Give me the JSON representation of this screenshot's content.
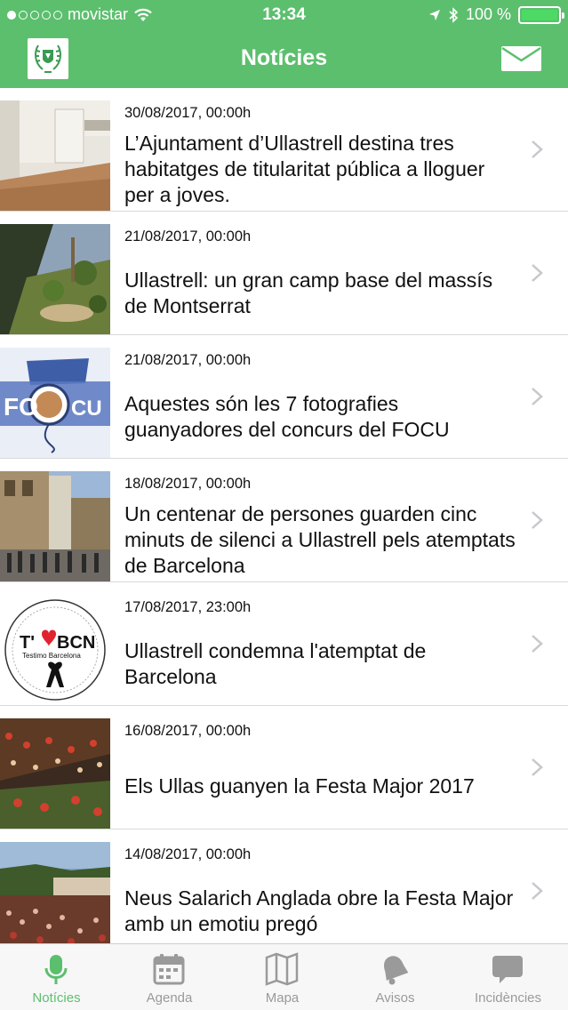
{
  "status_bar": {
    "carrier": "movistar",
    "time": "13:34",
    "battery": "100 %"
  },
  "header": {
    "title": "Notícies"
  },
  "news": [
    {
      "date": "30/08/2017, 00:00h",
      "title": "L’Ajuntament d’Ullastrell destina tres habitatges de titularitat pública a lloguer per a joves."
    },
    {
      "date": "21/08/2017, 00:00h",
      "title": "Ullastrell: un gran camp base del massís de Montserrat"
    },
    {
      "date": "21/08/2017, 00:00h",
      "title": "Aquestes són les 7 fotografies guanyadores del concurs del FOCU"
    },
    {
      "date": "18/08/2017, 00:00h",
      "title": "Un centenar de persones guarden cinc minuts de silenci a Ullastrell pels atemptats de Barcelona"
    },
    {
      "date": "17/08/2017, 23:00h",
      "title": "Ullastrell condemna l'atemptat de Barcelona"
    },
    {
      "date": "16/08/2017, 00:00h",
      "title": "Els Ullas guanyen la Festa Major 2017"
    },
    {
      "date": "14/08/2017, 00:00h",
      "title": "Neus Salarich Anglada obre la Festa Major amb un emotiu pregó"
    }
  ],
  "thumb_text": {
    "focu_a": "FO",
    "focu_b": "CU",
    "bcn_t": "T'",
    "bcn_bcn": "BCN",
    "bcn_sub": "Testimo Barcelona"
  },
  "tabs": [
    {
      "label": "Notícies",
      "icon": "microphone-icon",
      "active": true
    },
    {
      "label": "Agenda",
      "icon": "calendar-icon",
      "active": false
    },
    {
      "label": "Mapa",
      "icon": "map-icon",
      "active": false
    },
    {
      "label": "Avisos",
      "icon": "bell-icon",
      "active": false
    },
    {
      "label": "Incidències",
      "icon": "chat-icon",
      "active": false
    }
  ],
  "colors": {
    "brand": "#5cbf6e",
    "tab_inactive": "#9a9a9a"
  }
}
